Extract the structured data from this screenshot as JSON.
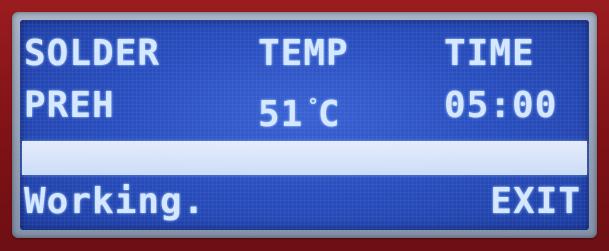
{
  "labels": {
    "solder": "SOLDER",
    "temp": "TEMP",
    "time": "TIME"
  },
  "values": {
    "mode": "PREH",
    "temperature": "51",
    "temperature_unit": "C",
    "degree_symbol": "°",
    "time": "05:00"
  },
  "status": {
    "text": "Working."
  },
  "actions": {
    "exit_label": "EXIT"
  },
  "progress": {
    "fraction": 1.0
  },
  "colors": {
    "screen_background": "#2a4fc0",
    "text": "#d5e8ff",
    "bezel": "#8e1418"
  }
}
